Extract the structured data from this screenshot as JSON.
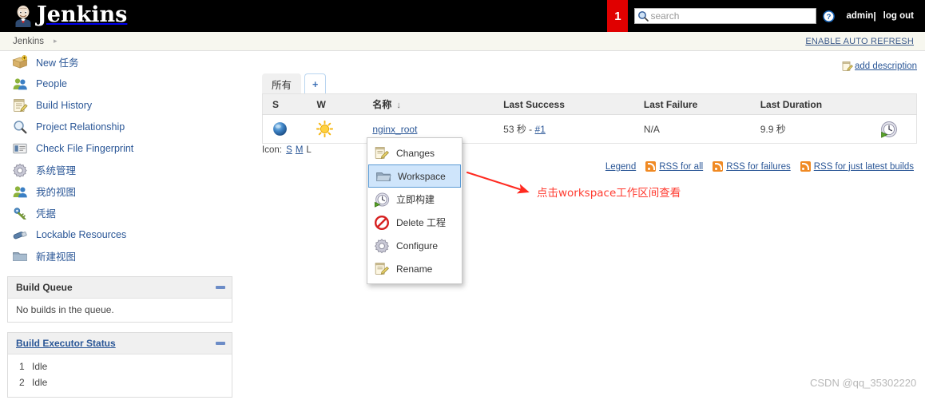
{
  "topbar": {
    "brand": "Jenkins",
    "badge_count": "1",
    "search_placeholder": "search",
    "search_value": "",
    "user": "admin",
    "logout": "log out",
    "separator": "|",
    "icons": {
      "logo": "jenkins-butler-logo",
      "search": "search-icon",
      "help": "help-icon"
    }
  },
  "breadcrumb": {
    "root": "Jenkins",
    "arrow": "▸",
    "auto_refresh": "ENABLE AUTO REFRESH"
  },
  "sidebar": {
    "tasks": [
      {
        "label": "New 任务",
        "icon": "new-job-icon"
      },
      {
        "label": "People",
        "icon": "people-icon"
      },
      {
        "label": "Build History",
        "icon": "build-history-icon"
      },
      {
        "label": "Project Relationship",
        "icon": "magnifier-icon"
      },
      {
        "label": "Check File Fingerprint",
        "icon": "fingerprint-icon"
      },
      {
        "label": "系统管理",
        "icon": "gear-icon"
      },
      {
        "label": "我的视图",
        "icon": "my-views-icon"
      },
      {
        "label": "凭据",
        "icon": "credentials-icon"
      },
      {
        "label": "Lockable Resources",
        "icon": "lock-resource-icon"
      },
      {
        "label": "新建视图",
        "icon": "folder-icon"
      }
    ],
    "build_queue": {
      "title": "Build Queue",
      "empty_text": "No builds in the queue."
    },
    "executor_status": {
      "title": "Build Executor Status",
      "executors": [
        {
          "num": "1",
          "state": "Idle"
        },
        {
          "num": "2",
          "state": "Idle"
        }
      ]
    }
  },
  "main": {
    "add_description": "add description",
    "tabs": [
      {
        "label": "所有",
        "active": true
      },
      {
        "label": "+",
        "active": false
      }
    ],
    "table": {
      "columns": [
        "S",
        "W",
        "名称",
        "Last Success",
        "Last Failure",
        "Last Duration",
        ""
      ],
      "sort_indicator": "↓",
      "sorted_column": "名称",
      "rows": [
        {
          "status_icon": "blue-ball-success-icon",
          "weather_icon": "sunny-weather-icon",
          "name": "nginx_root",
          "last_success": "53 秒 - ",
          "last_success_build": "#1",
          "last_failure": "N/A",
          "last_duration": "9.9 秒",
          "action_icon": "schedule-build-icon"
        }
      ]
    },
    "icon_size": {
      "label": "Icon:",
      "options": [
        {
          "label": "S",
          "link": true
        },
        {
          "label": "M",
          "link": true
        },
        {
          "label": "L",
          "link": false
        }
      ]
    },
    "footer_links": {
      "legend": "Legend",
      "rss_all": "RSS for all",
      "rss_failures": "RSS for failures",
      "rss_latest": "RSS for just latest builds"
    }
  },
  "context_menu": {
    "items": [
      {
        "label": "Changes",
        "icon": "changes-icon",
        "selected": false
      },
      {
        "label": "Workspace",
        "icon": "workspace-folder-icon",
        "selected": true
      },
      {
        "label": "立即构建",
        "icon": "build-now-icon",
        "selected": false
      },
      {
        "label": "Delete 工程",
        "icon": "delete-icon",
        "selected": false
      },
      {
        "label": "Configure",
        "icon": "gear-icon",
        "selected": false
      },
      {
        "label": "Rename",
        "icon": "rename-icon",
        "selected": false
      }
    ]
  },
  "annotation": {
    "text": "点击workspace工作区间查看",
    "color": "#ff3b30",
    "arrow": "red-arrow-pointing-to-workspace"
  },
  "watermark": "CSDN @qq_35302220",
  "colors": {
    "topbar_bg": "#000000",
    "badge_red": "#e00000",
    "link_blue": "#2b5797",
    "breadcrumb_bg": "#f7f7ef",
    "table_head_bg": "#f0f0f0",
    "menu_selected_bg": "#cfe5fb",
    "annotation_red": "#ff3b30",
    "rss_orange": "#f08a24"
  }
}
